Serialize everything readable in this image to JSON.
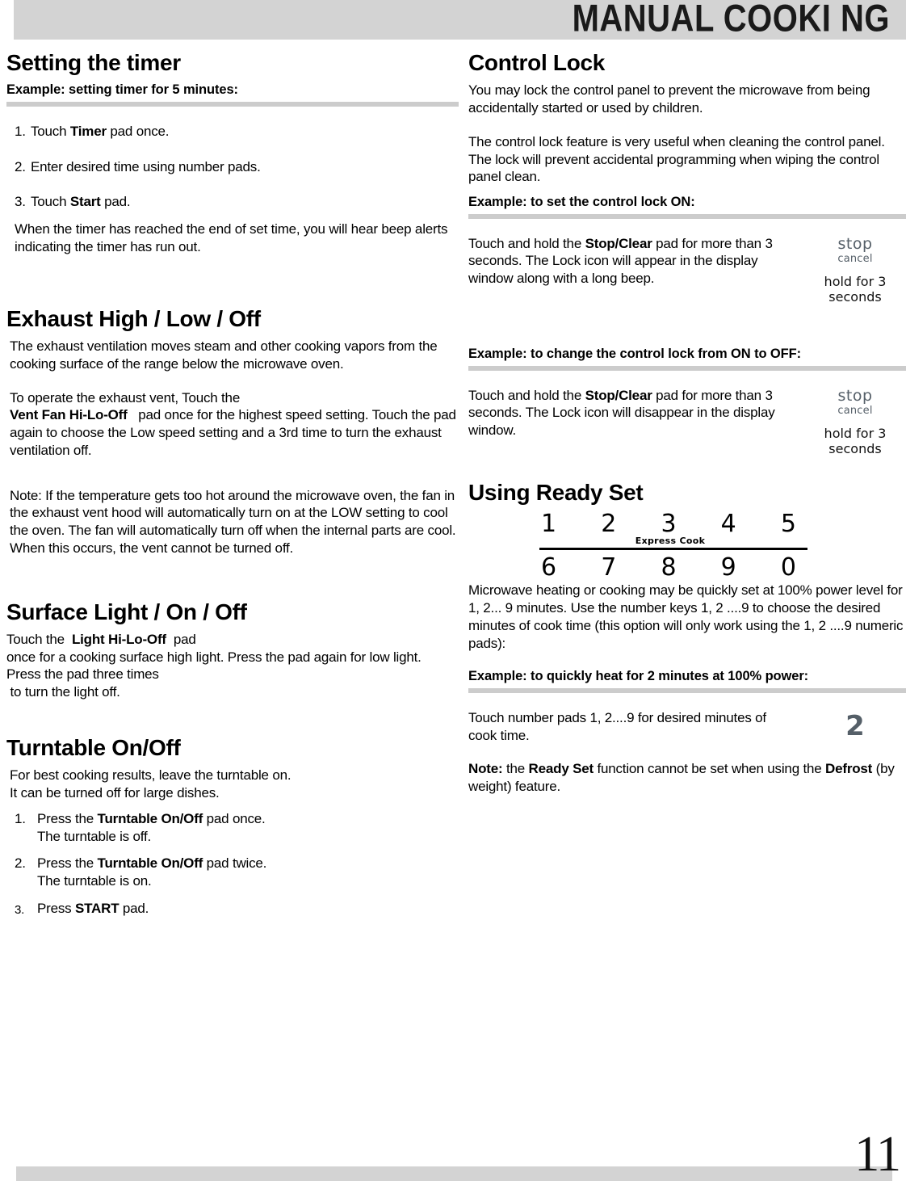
{
  "header": {
    "title": "MANUAL COOKI NG"
  },
  "footer": {
    "page_number": "11"
  },
  "left_column": {
    "timer": {
      "title": "Setting the timer",
      "example_head": "Example: setting timer for 5 minutes:",
      "steps": [
        {
          "num": "1.",
          "pre": "Touch ",
          "bold": "Timer",
          "post": " pad once."
        },
        {
          "num": "2.",
          "pre": "Enter desired time using number pads.",
          "bold": "",
          "post": ""
        },
        {
          "num": "3.",
          "pre": "Touch ",
          "bold": "Start",
          "post": " pad."
        }
      ],
      "closing": "When the timer has reached the end of set time, you will hear beep alerts indicating the timer has run out."
    },
    "exhaust": {
      "title": "Exhaust High / Low / Off",
      "para1": "The exhaust ventilation moves steam and other cooking vapors from the cooking surface of the range below the microwave oven.",
      "para2_pre": "To operate the exhaust vent, Touch the",
      "para2_pad": "Vent  Fan Hi-Lo-Off",
      "para2_post": "pad once for the highest speed setting. Touch the pad again to choose the Low speed setting and a 3rd time to turn the exhaust ventilation off.",
      "note": "Note: If the temperature gets too hot around the microwave oven, the fan in the exhaust vent hood will automatically turn on at the LOW setting to cool the oven. The fan will automatically turn off when the internal parts are cool. When this occurs, the vent cannot be turned off."
    },
    "surface_light": {
      "title": "Surface Light / On / Off",
      "pre": "Touch the",
      "pad": "Light Hi-Lo-Off",
      "post": "pad",
      "line2": "once for a cooking surface high light. Press the pad again for low light. Press the pad three times",
      "line3": "to turn the light off."
    },
    "turntable": {
      "title": "Turntable On/Off",
      "intro_line1": "For best cooking results, leave the turntable on.",
      "intro_line2": "It can be  turned  off for large dishes.",
      "steps": [
        {
          "num": "1.",
          "pre": "Press the ",
          "bold": "Turntable On/Off",
          "post": " pad once.",
          "sub": "The turntable is off."
        },
        {
          "num": "2.",
          "pre": "Press the ",
          "bold": "Turntable On/Off",
          "post": " pad twice.",
          "sub": "The turntable is on."
        },
        {
          "num": "3.",
          "pre": "Press ",
          "bold": "START",
          "post": " pad.",
          "sub": ""
        }
      ]
    }
  },
  "right_column": {
    "control_lock": {
      "title": "Control Lock",
      "para1": "You may lock the control panel to prevent the microwave from being accidentally started or used by children.",
      "para2": "The control lock feature is very useful when cleaning the control panel. The lock will prevent accidental programming when wiping the control panel clean.",
      "example_on_head": "Example: to set the control lock ON:",
      "example_on_pre": "Touch and hold the ",
      "example_on_bold": "Stop/Clear",
      "example_on_post": " pad for more than 3 seconds. The Lock icon will appear in the display window along with a long beep.",
      "example_off_head": "Example: to change the control lock from ON to OFF:",
      "example_off_pre": "Touch and hold the ",
      "example_off_bold": "Stop/Clear",
      "example_off_post": " pad for more than 3 seconds. The Lock icon will disappear in the display window.",
      "pad_icon": {
        "stop": "stop",
        "cancel": "cancel",
        "hold_line1": "hold for 3",
        "hold_line2": "seconds"
      }
    },
    "ready_set": {
      "title": "Using Ready Set",
      "keypad": {
        "row1": [
          "1",
          "2",
          "3",
          "4",
          "5"
        ],
        "row2": [
          "6",
          "7",
          "8",
          "9",
          "0"
        ],
        "express_label": "Express Cook"
      },
      "para": "Microwave heating or cooking may be quickly set at 100% power level for 1, 2... 9 minutes. Use the number keys  1, 2 ....9 to choose the desired minutes of cook time (this option will only work using the 1, 2 ....9 numeric pads):",
      "example_head": "Example: to quickly heat for 2 minutes at 100% power:",
      "example_text": "Touch number pads 1, 2....9 for desired minutes of cook time.",
      "example_digit": "2",
      "note_pre": "Note:",
      "note_mid1": " the ",
      "note_bold1": "Ready Set",
      "note_mid2": " function cannot be set when using the ",
      "note_bold2": "Defrost",
      "note_end": " (by weight) feature."
    }
  },
  "colors": {
    "header_bar": "#d3d3d3",
    "rule": "#cccccc",
    "pad_gray": "#555f68",
    "text": "#000000"
  }
}
